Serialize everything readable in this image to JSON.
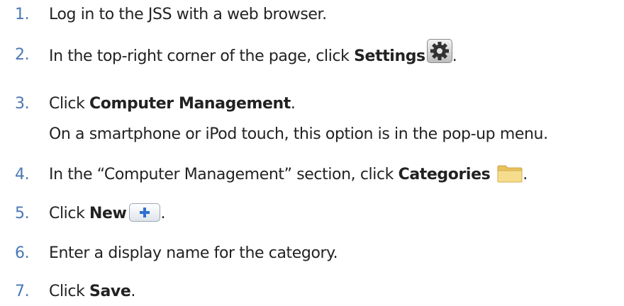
{
  "steps": [
    {
      "number": "1.",
      "parts": {
        "t1": "Log in to the JSS with a web browser."
      }
    },
    {
      "number": "2.",
      "parts": {
        "t1": "In the top-right corner of the page, click ",
        "b1": "Settings",
        "t2": "."
      },
      "icon": "gear-icon"
    },
    {
      "number": "3.",
      "parts": {
        "t1": "Click ",
        "b1": "Computer Management",
        "t2": "."
      },
      "note": "On a smartphone or iPod touch, this option is in the pop-up menu."
    },
    {
      "number": "4.",
      "parts": {
        "t1": "In the “Computer Management” section, click ",
        "b1": "Categories",
        "t2": "."
      },
      "icon": "folder-icon"
    },
    {
      "number": "5.",
      "parts": {
        "t1": "Click ",
        "b1": "New",
        "t2": "."
      },
      "icon": "plus-icon"
    },
    {
      "number": "6.",
      "parts": {
        "t1": "Enter a display name for the category."
      }
    },
    {
      "number": "7.",
      "parts": {
        "t1": "Click ",
        "b1": "Save",
        "t2": "."
      }
    }
  ],
  "colors": {
    "number": "#4a78b5",
    "text": "#222222",
    "folder": "#f3d98b",
    "plus": "#2f6fd0"
  }
}
